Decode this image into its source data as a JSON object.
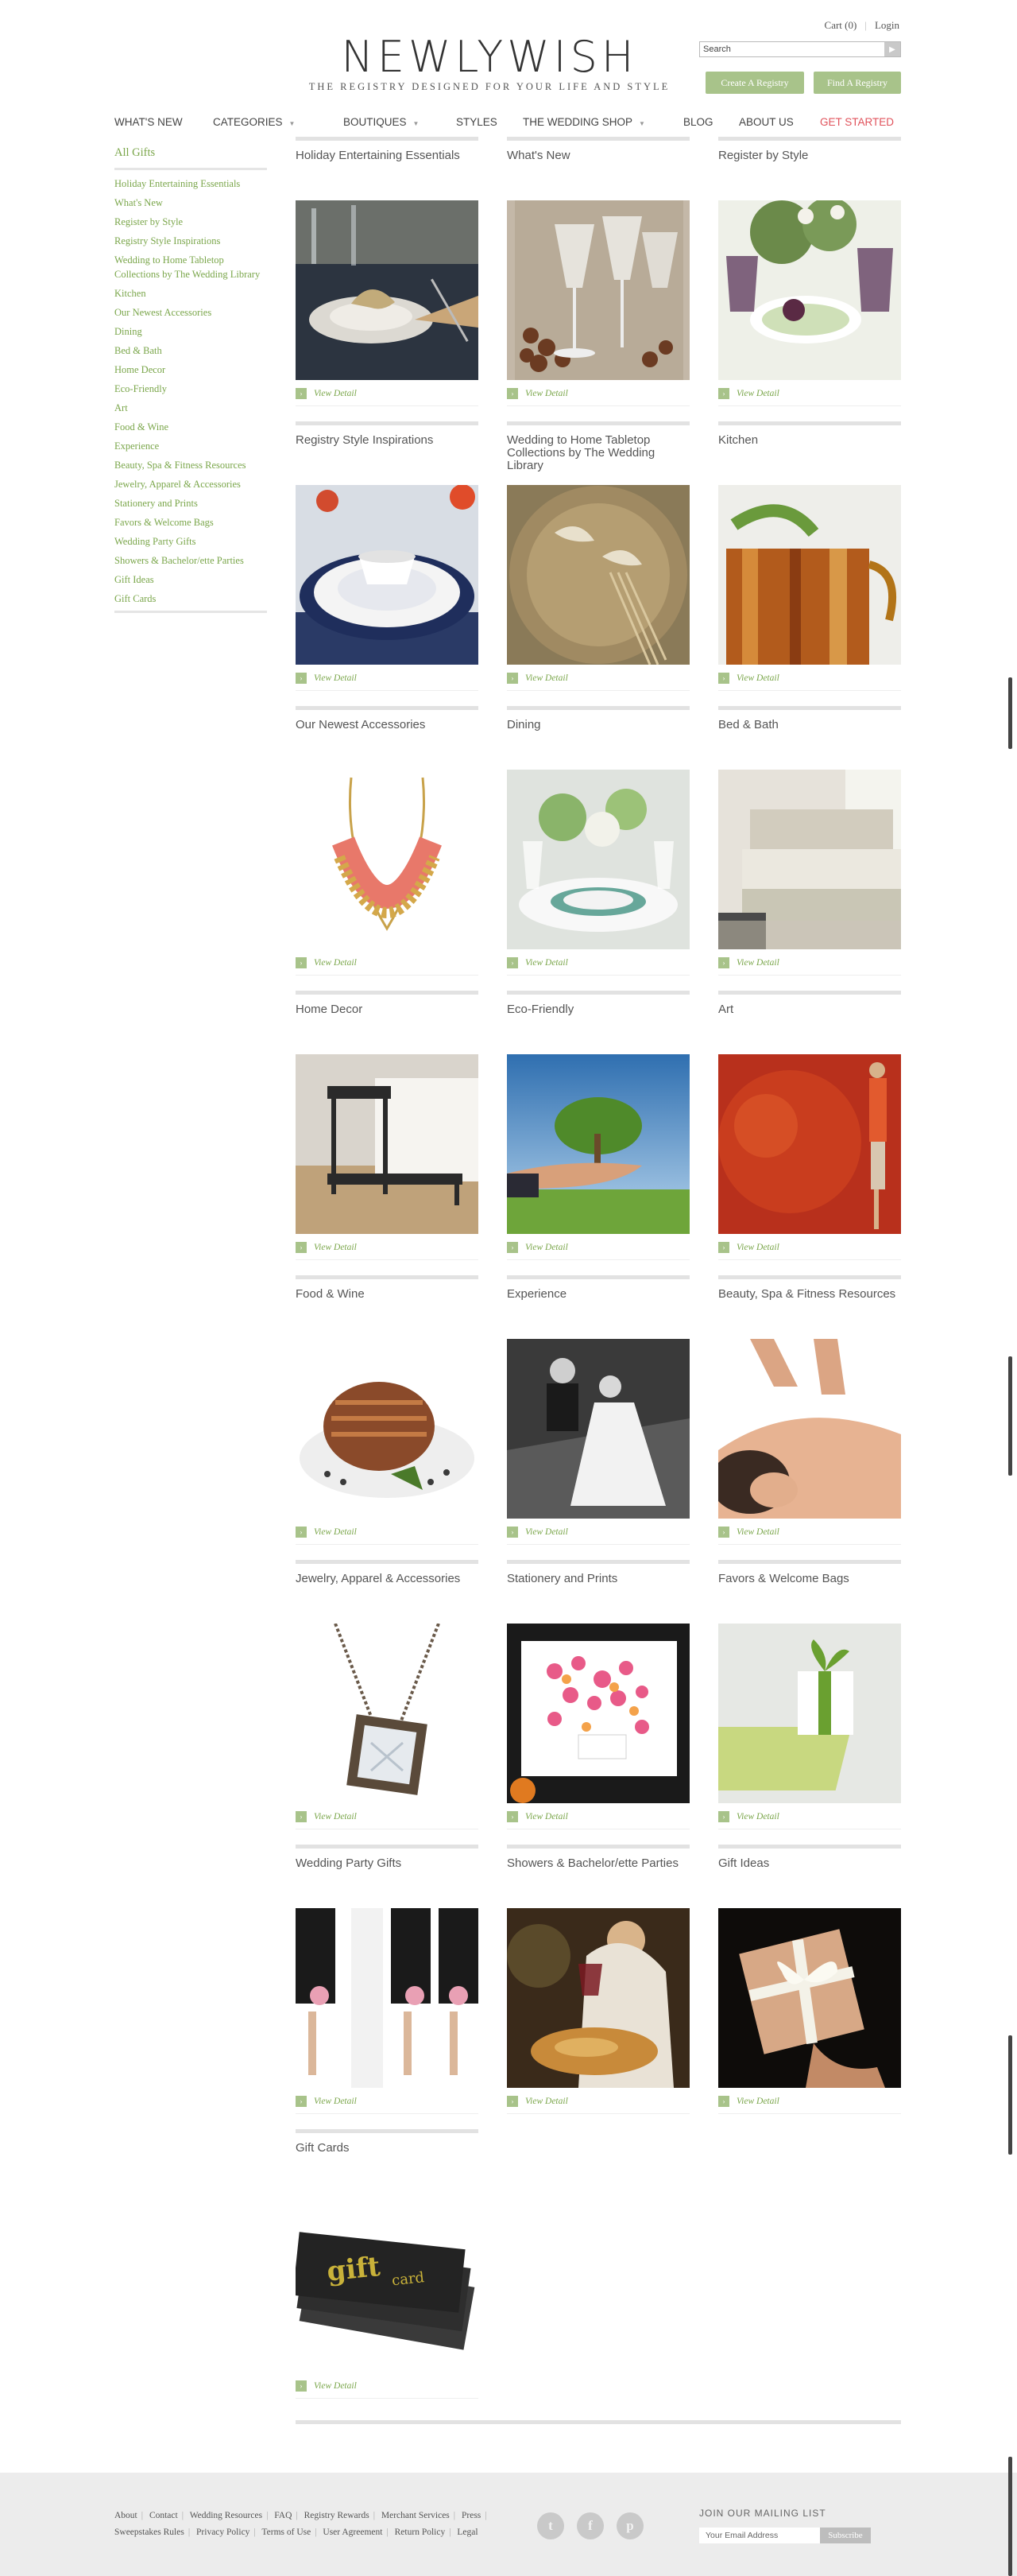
{
  "header": {
    "cart": "Cart (0)",
    "login": "Login",
    "logo": "NEWLYWISH",
    "tagline": "THE REGISTRY DESIGNED FOR YOUR LIFE AND STYLE",
    "search_value": "Search",
    "create_registry": "Create A Registry",
    "find_registry": "Find A Registry"
  },
  "nav": {
    "whats_new": "WHAT'S NEW",
    "categories": "CATEGORIES",
    "boutiques": "BOUTIQUES",
    "styles": "STYLES",
    "wedding_shop": "THE WEDDING SHOP",
    "blog": "BLOG",
    "about": "ABOUT US",
    "get_started": "GET STARTED"
  },
  "sidebar": {
    "heading": "All Gifts",
    "items": [
      "Holiday Entertaining Essentials",
      "What's New",
      "Register by Style",
      "Registry Style Inspirations",
      "Wedding to Home Tabletop Collections by The Wedding Library",
      "Kitchen",
      "Our Newest Accessories",
      "Dining",
      "Bed & Bath",
      "Home Decor",
      "Eco-Friendly",
      "Art",
      "Food & Wine",
      "Experience",
      "Beauty, Spa & Fitness Resources",
      "Jewelry, Apparel & Accessories",
      "Stationery and Prints",
      "Favors & Welcome Bags",
      "Wedding Party Gifts",
      "Showers & Bachelor/ette Parties",
      "Gift Ideas",
      "Gift Cards"
    ]
  },
  "grid": {
    "view_detail": "View Detail",
    "categories": [
      "Holiday Entertaining Essentials",
      "What's New",
      "Register by Style",
      "Registry Style Inspirations",
      "Wedding to Home Tabletop Collections by The Wedding Library",
      "Kitchen",
      "Our Newest Accessories",
      "Dining",
      "Bed & Bath",
      "Home Decor",
      "Eco-Friendly",
      "Art",
      "Food & Wine",
      "Experience",
      "Beauty, Spa & Fitness Resources",
      "Jewelry, Apparel & Accessories",
      "Stationery and Prints",
      "Favors & Welcome Bags",
      "Wedding Party Gifts",
      "Showers & Bachelor/ette Parties",
      "Gift Ideas",
      "Gift Cards"
    ],
    "gift_card_text_1": "gift",
    "gift_card_text_2": "card"
  },
  "footer": {
    "links_row1": [
      "About",
      "Contact",
      "Wedding Resources",
      "FAQ",
      "Registry Rewards",
      "Merchant Services",
      "Press"
    ],
    "links_row2": [
      "Sweepstakes Rules",
      "Privacy Policy",
      "Terms of Use",
      "User Agreement",
      "Return Policy",
      "Legal"
    ],
    "mailing_title": "JOIN OUR MAILING LIST",
    "email_placeholder": "Your Email Address",
    "subscribe": "Subscribe",
    "social": [
      "twitter-icon",
      "facebook-icon",
      "pinterest-icon"
    ]
  },
  "colors": {
    "brand_green": "#7aa64a",
    "button_green": "#a8c38a",
    "get_started_red": "#e0525b"
  }
}
